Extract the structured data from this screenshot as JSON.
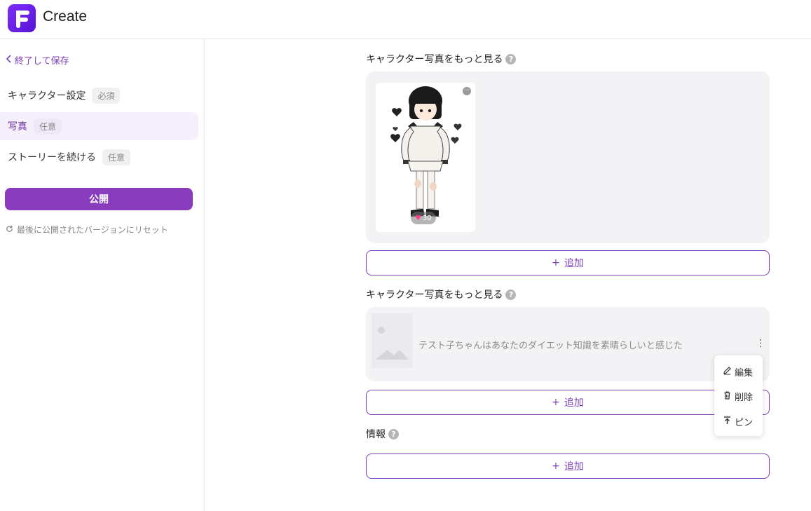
{
  "header": {
    "app_title": "Create",
    "logo_letter": "F"
  },
  "sidebar": {
    "back_label": "終了して保存",
    "items": [
      {
        "label": "キャラクター設定",
        "badge": "必須",
        "active": false
      },
      {
        "label": "写真",
        "badge": "任意",
        "active": true
      },
      {
        "label": "ストーリーを続ける",
        "badge": "任意",
        "active": false
      }
    ],
    "publish_label": "公開",
    "reset_label": "最後に公開されたバージョンにリセット"
  },
  "main": {
    "sections": [
      {
        "title": "キャラクター写真をもっと見る",
        "add_label": "追加"
      },
      {
        "title": "キャラクター写真をもっと見る",
        "add_label": "追加"
      },
      {
        "title": "情報",
        "add_label": "追加"
      }
    ],
    "photo": {
      "likes": "30"
    },
    "story": {
      "text": "テスト子ちゃんはあなたのダイエット知識を素晴らしいと感じた"
    },
    "context_menu": {
      "edit": "編集",
      "delete": "削除",
      "pin": "ピン"
    }
  },
  "colors": {
    "accent": "#8a3cbf",
    "accent_text": "#7b3fb8",
    "active_bg": "#f6effc",
    "panel_bg": "#f3f3f5"
  },
  "icons": [
    "logo-icon",
    "chevron-left-icon",
    "refresh-icon",
    "help-icon",
    "more-icon",
    "heart-icon",
    "image-placeholder-icon",
    "kebab-icon",
    "pencil-icon",
    "trash-icon",
    "pin-icon",
    "plus-icon"
  ]
}
